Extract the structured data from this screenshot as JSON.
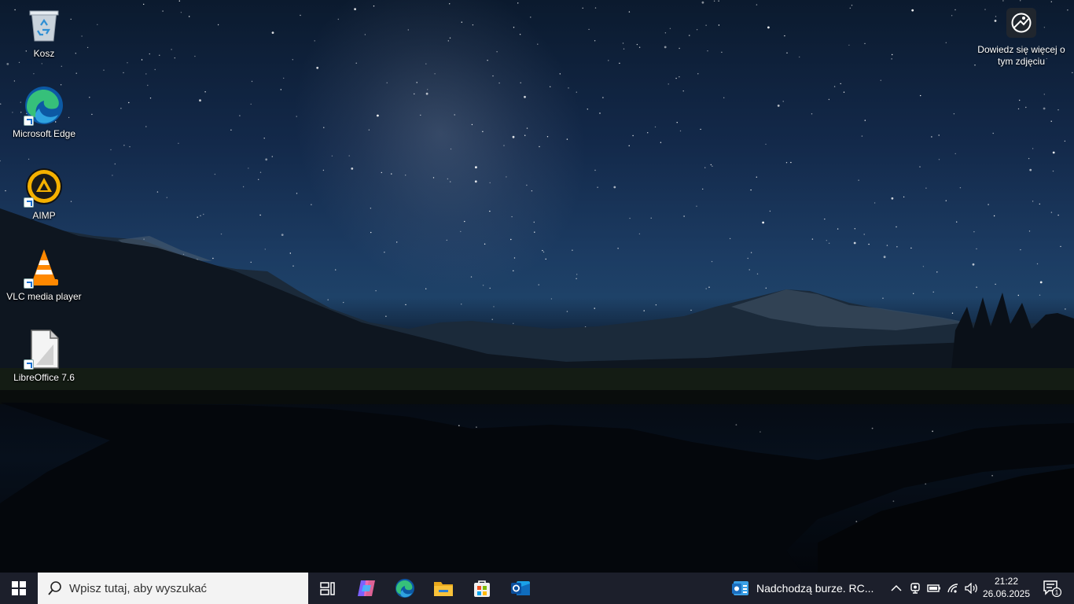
{
  "desktop": {
    "icons": [
      {
        "label": "Kosz",
        "icon": "recycle-bin-icon"
      },
      {
        "label": "Microsoft Edge",
        "icon": "edge-icon"
      },
      {
        "label": "AIMP",
        "icon": "aimp-icon"
      },
      {
        "label": "VLC media player",
        "icon": "vlc-icon"
      },
      {
        "label": "LibreOffice 7.6",
        "icon": "libreoffice-icon"
      }
    ],
    "learn_more": {
      "label": "Dowiedz się więcej o tym zdjęciu",
      "icon": "camera-info-icon"
    }
  },
  "taskbar": {
    "search_placeholder": "Wpisz tutaj, aby wyszukać",
    "pinned": [
      "task-view-icon",
      "copilot-icon",
      "edge-icon",
      "file-explorer-icon",
      "store-icon",
      "outlook-icon"
    ],
    "weather": "Nadchodzą burze. RC...",
    "clock": {
      "time": "21:22",
      "date": "26.06.2025"
    },
    "notifications_count": "1"
  },
  "colors": {
    "taskbar": "#1c1f2b",
    "search_bg": "#f3f3f3",
    "accent": "#0078d4"
  }
}
